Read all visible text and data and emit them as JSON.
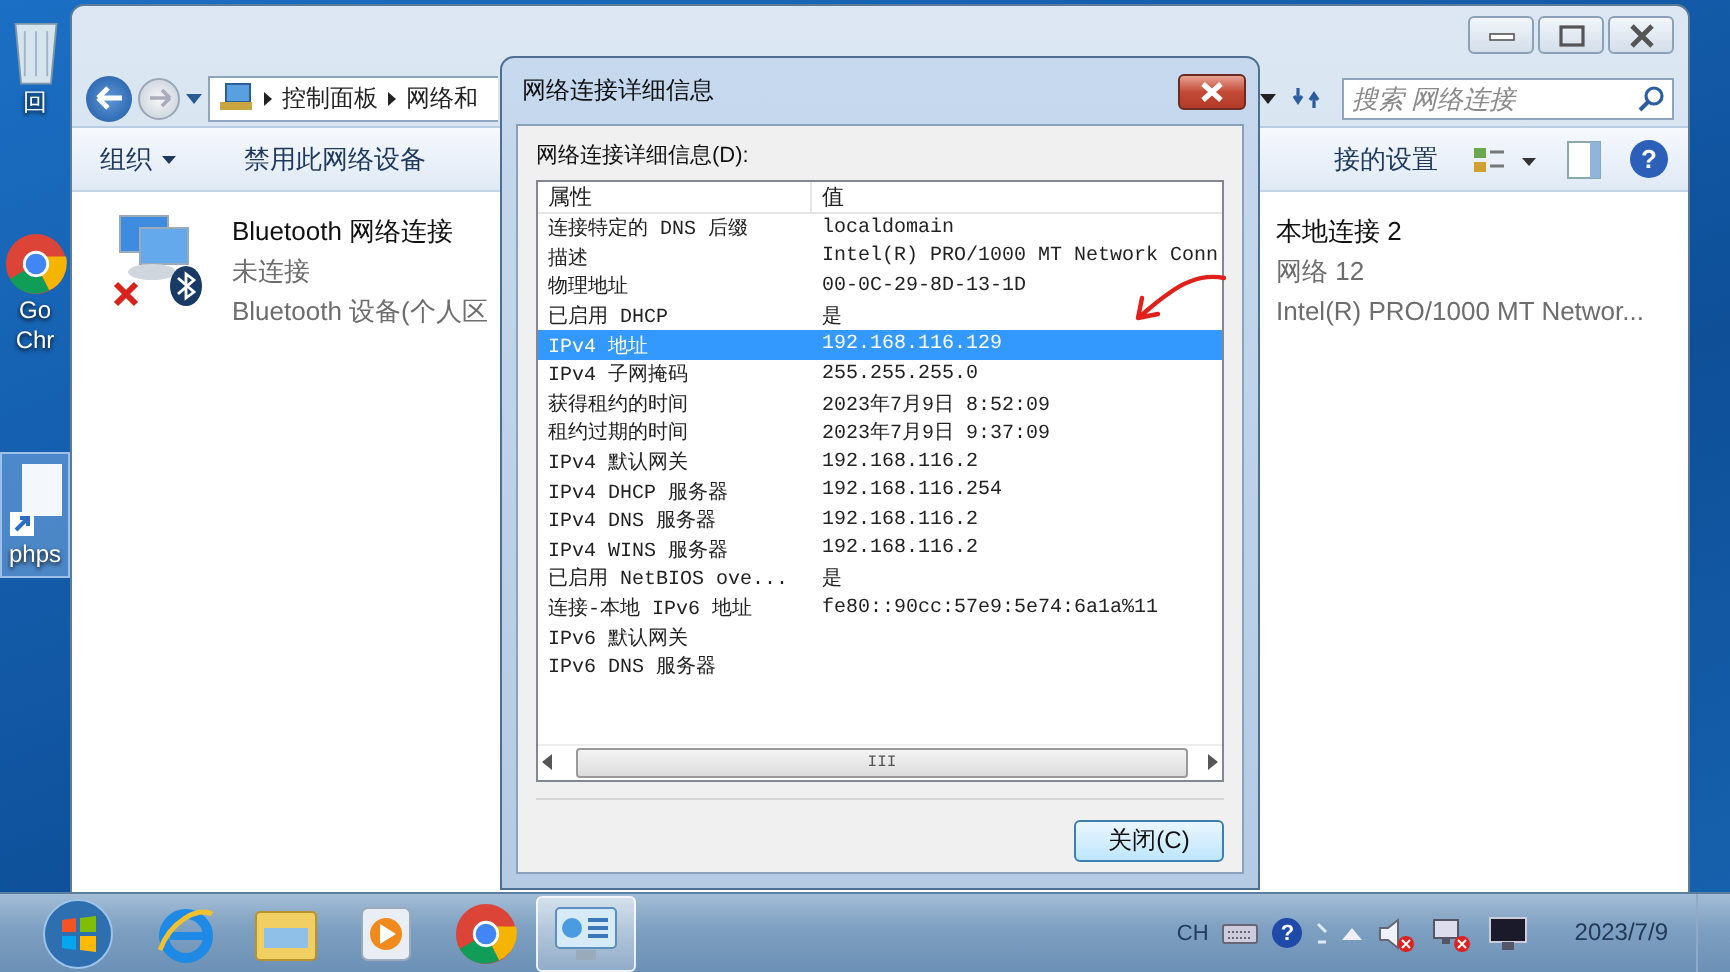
{
  "desktop_icons": [
    {
      "kind": "recycle-bin",
      "label_lines": [
        "回"
      ],
      "selected": false
    },
    {
      "kind": "chrome",
      "label_lines": [
        "Go",
        "Chr"
      ],
      "selected": false
    },
    {
      "kind": "shortcut",
      "label_lines": [
        "phps"
      ],
      "selected": true
    }
  ],
  "explorer": {
    "breadcrumb": [
      "控制面板",
      "网络和"
    ],
    "search": {
      "placeholder": "搜索 网络连接"
    },
    "toolbar": [
      {
        "label": "组织",
        "kind": "menu"
      },
      {
        "label": "禁用此网络设备",
        "kind": "button"
      }
    ],
    "toolbar_right": "接的设置",
    "help_glyph": "?",
    "connections": [
      {
        "name": "Bluetooth 网络连接",
        "status": "未连接",
        "device": "Bluetooth 设备(个人区",
        "kind": "bluetooth",
        "disconnected": true
      },
      {
        "name": "本地连接 2",
        "status": "网络 12",
        "device": "Intel(R) PRO/1000 MT Networ..."
      }
    ]
  },
  "dialog": {
    "title": "网络连接详细信息",
    "list_label": "网络连接详细信息(D):",
    "columns": [
      "属性",
      "值"
    ],
    "rows": [
      {
        "property": "连接特定的 DNS 后缀",
        "value": "localdomain",
        "selected": false
      },
      {
        "property": "描述",
        "value": "Intel(R) PRO/1000 MT Network Conn",
        "selected": false
      },
      {
        "property": "物理地址",
        "value": "00-0C-29-8D-13-1D",
        "selected": false
      },
      {
        "property": "已启用 DHCP",
        "value": "是",
        "selected": false
      },
      {
        "property": "IPv4 地址",
        "value": "192.168.116.129",
        "selected": true
      },
      {
        "property": "IPv4 子网掩码",
        "value": "255.255.255.0",
        "selected": false
      },
      {
        "property": "获得租约的时间",
        "value": "2023年7月9日 8:52:09",
        "selected": false
      },
      {
        "property": "租约过期的时间",
        "value": "2023年7月9日 9:37:09",
        "selected": false
      },
      {
        "property": "IPv4 默认网关",
        "value": "192.168.116.2",
        "selected": false
      },
      {
        "property": "IPv4 DHCP 服务器",
        "value": "192.168.116.254",
        "selected": false
      },
      {
        "property": "IPv4 DNS 服务器",
        "value": "192.168.116.2",
        "selected": false
      },
      {
        "property": "IPv4 WINS 服务器",
        "value": "192.168.116.2",
        "selected": false
      },
      {
        "property": "已启用 NetBIOS ove...",
        "value": "是",
        "selected": false
      },
      {
        "property": "连接-本地 IPv6 地址",
        "value": "fe80::90cc:57e9:5e74:6a1a%11",
        "selected": false
      },
      {
        "property": "IPv6 默认网关",
        "selected": false
      },
      {
        "property": "IPv6 DNS 服务器",
        "selected": false
      }
    ],
    "scroll_thumb": "III",
    "close_button": "关闭(C)"
  },
  "taskbar": {
    "apps": [
      {
        "kind": "ie",
        "active": false
      },
      {
        "kind": "folder",
        "active": false
      },
      {
        "kind": "media",
        "active": false
      },
      {
        "kind": "chrome",
        "active": false
      },
      {
        "kind": "control-panel",
        "active": true
      }
    ],
    "tray": {
      "language": "CH",
      "help_glyph": "?",
      "date": "2023/7/9"
    }
  }
}
